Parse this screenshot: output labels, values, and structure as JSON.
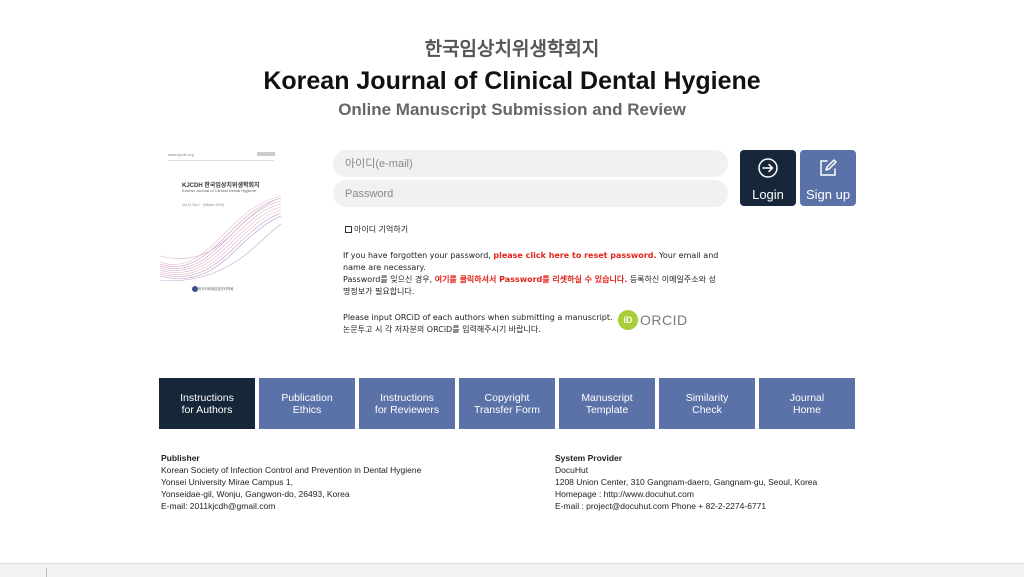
{
  "header": {
    "title_ko": "한국임상치위생학회지",
    "title_en": "Korean Journal of Clinical Dental Hygiene",
    "subtitle": "Online Manuscript Submission and Review"
  },
  "cover": {
    "url": "www.kjcdh.org",
    "title": "KJCDH 한국임상치위생학회지",
    "subtitle": "Korean Journal of Clinical Dental Hygiene",
    "volume": "Vol.11 No.1 · (Winter 2023)",
    "society": "한국치위생감염관리학회"
  },
  "login": {
    "id_placeholder": "아이디(e-mail)",
    "password_placeholder": "Password",
    "login_label": "Login",
    "signup_label": "Sign up",
    "remember_label": "아이디 기억하기"
  },
  "notices": {
    "forgot_en_pre": "If you have forgotten your password, ",
    "forgot_en_link": "please click here to reset password.",
    "forgot_en_post": " Your email and name are necessary.",
    "forgot_ko_pre": "Password를 잊으신 경우, ",
    "forgot_ko_link": "여기를 클릭하셔서 Password를 리셋하실 수 있습니다.",
    "forgot_ko_post": " 등록하신 이메일주소와 성명정보가 필요합니다.",
    "orcid_en": "Please input ORCiD of each authors when submitting a manuscript.",
    "orcid_ko": "논문투고 시 각 저자분의 ORCiD를 입력해주시기 바랍니다.",
    "orcid_badge": "iD",
    "orcid_text": "ORCID"
  },
  "nav": {
    "tabs": [
      {
        "line1": "Instructions",
        "line2": "for Authors"
      },
      {
        "line1": "Publication",
        "line2": "Ethics"
      },
      {
        "line1": "Instructions",
        "line2": "for Reviewers"
      },
      {
        "line1": "Copyright",
        "line2": "Transfer Form"
      },
      {
        "line1": "Manuscript",
        "line2": "Template"
      },
      {
        "line1": "Similarity",
        "line2": "Check"
      },
      {
        "line1": "Journal",
        "line2": "Home"
      }
    ]
  },
  "footer": {
    "publisher": {
      "title": "Publisher",
      "lines": [
        "Korean Society of Infection Control and Prevention in Dental Hygiene",
        "Yonsei University Mirae Campus 1,",
        "Yonseidae-gil, Wonju, Gangwon-do, 26493, Korea",
        "E-mail: 2011kjcdh@gmail.com"
      ]
    },
    "provider": {
      "title": "System Provider",
      "lines": [
        "DocuHut",
        "1208 Union Center, 310 Gangnam-daero, Gangnam-gu, Seoul, Korea",
        "Homepage : http://www.docuhut.com",
        "E-mail : project@docuhut.com  Phone + 82-2-2274-6771"
      ]
    }
  },
  "colors": {
    "dark_navy": "#17273a",
    "accent_blue": "#5b72a8",
    "link_red": "#e2231a",
    "orcid_green": "#a6ce39"
  },
  "icons": {
    "login": "login-arrow-icon",
    "signup": "pencil-edit-icon"
  }
}
